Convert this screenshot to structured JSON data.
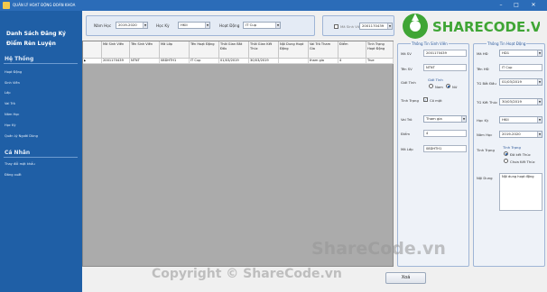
{
  "window": {
    "title": "QUẢN LÝ HOẠT ĐỘNG ĐOÀN KHOA",
    "minimize": "–",
    "maximize": "□",
    "close": "✕"
  },
  "sidebar": {
    "heading_line1": "Danh Sách Đăng Ký",
    "heading_line2": "Điểm Rèn Luyện",
    "sections": [
      {
        "title": "Hệ Thống",
        "items": [
          "Hoạt Động",
          "Sinh Viên",
          "Lớp",
          "Vai Trò",
          "Năm Học",
          "Học Kỳ",
          "Quản Lý Người Dùng"
        ]
      },
      {
        "title": "Cá Nhân",
        "items": [
          "Thay đổi mật khẩu",
          "Đăng xuất"
        ]
      }
    ]
  },
  "filter": {
    "nam_hoc_label": "Năm Học",
    "nam_hoc_value": "2019-2020",
    "hoc_ky_label": "Học Kỳ",
    "hoc_ky_value": "HKII",
    "hoat_dong_label": "Hoạt Động",
    "hoat_dong_value": "IT Cup",
    "ma_sv_check_label": "Mã Sinh Viên",
    "ma_sv_value": "2001170439"
  },
  "grid": {
    "columns": [
      "Mã Sinh Viên",
      "Tên Sinh Viên",
      "Mã Lớp",
      "Tên Hoạt Động",
      "Thời Gian Bắt Đầu",
      "Thời Gian Kết Thúc",
      "Nội Dung Hoạt Động",
      "Vai Trò Tham Gia",
      "Điểm",
      "Tình Trạng Hoạt Động"
    ],
    "rows": [
      [
        "2001170439",
        "NTNT",
        "08DHTH1",
        "IT Cup",
        "01/03/2019",
        "30/03/2019",
        "",
        "tham gia",
        "4",
        "True"
      ]
    ]
  },
  "student_panel": {
    "title": "Thông Tin Sinh Viên",
    "ma_sv_label": "Mã SV",
    "ma_sv_value": "2001170439",
    "ten_sv_label": "Tên SV",
    "ten_sv_value": "NTNT",
    "gioi_tinh_label": "Giới Tính",
    "gioi_tinh_group": "Giới Tính",
    "nam_label": "Nam",
    "nu_label": "Nữ",
    "tinh_trang_label": "Tình Trạng",
    "co_mat_label": "Có mặt",
    "vai_tro_label": "Vai Trò",
    "vai_tro_value": "Tham gia",
    "diem_label": "Điểm",
    "diem_value": "4",
    "ma_lop_label": "Mã Lớp",
    "ma_lop_value": "08DHTH1"
  },
  "activity_panel": {
    "title": "Thông Tin Hoạt Động",
    "ma_hd_label": "Mã HĐ",
    "ma_hd_value": "HD1",
    "ten_hd_label": "Tên HĐ",
    "ten_hd_value": "IT Cup",
    "tg_bat_dau_label": "TG Bắt Đầu",
    "tg_bat_dau_value": "01/03/2019",
    "tg_ket_thuc_label": "TG Kết Thúc",
    "tg_ket_thuc_value": "30/03/2019",
    "hoc_ky_label": "Học Kỳ",
    "hoc_ky_value": "HKII",
    "nam_hoc_label": "Năm Học",
    "nam_hoc_value": "2019-2020",
    "tinh_trang_label": "Tình Trạng",
    "tinh_trang_group": "Tình Trạng",
    "da_ket_thuc_label": "Đã kết Thúc",
    "chua_ket_thuc_label": "Chưa Kết Thúc",
    "noi_dung_label": "Nội Dung",
    "noi_dung_value": "Nội dung hoạt động"
  },
  "actions": {
    "delete_label": "Xoá"
  },
  "watermark": {
    "logo_text": "SHARECODE.VN",
    "center_text": "ShareCode.vn",
    "copyright_text": "Copyright © ShareCode.vn"
  },
  "colors": {
    "sidebar": "#1f5fa6",
    "titlebar": "#2b6cb8",
    "grid_background": "#ababab",
    "watermark_green": "#3fa535"
  }
}
